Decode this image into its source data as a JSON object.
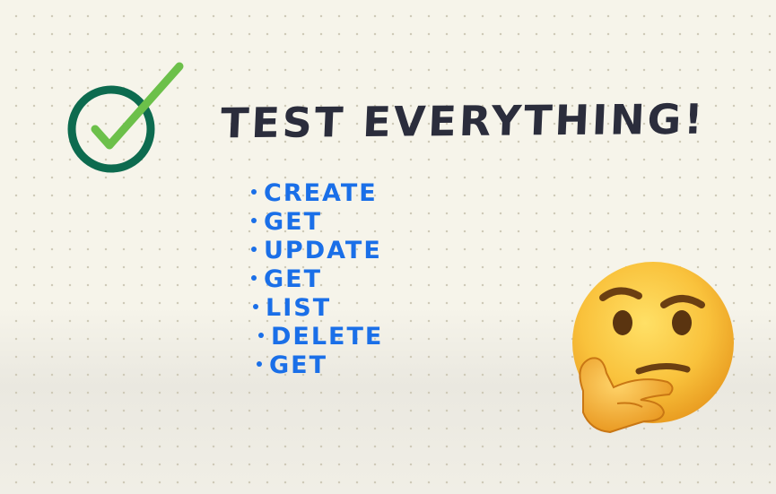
{
  "title": "TEST EVERYTHING!",
  "checklist": [
    {
      "label": "CREATE"
    },
    {
      "label": "GET"
    },
    {
      "label": "UPDATE"
    },
    {
      "label": "GET"
    },
    {
      "label": "LIST"
    },
    {
      "label": "DELETE"
    },
    {
      "label": "GET"
    }
  ],
  "icons": {
    "check": "check-circle-icon",
    "emoji": "thinking-face-emoji"
  },
  "colors": {
    "background": "#f6f4ea",
    "dots": "#cfcab8",
    "title": "#2b2d3c",
    "list": "#1a6fe8",
    "ring": "#0d6b4f",
    "check": "#6cc04a",
    "emoji_face": "#f6b73c"
  }
}
